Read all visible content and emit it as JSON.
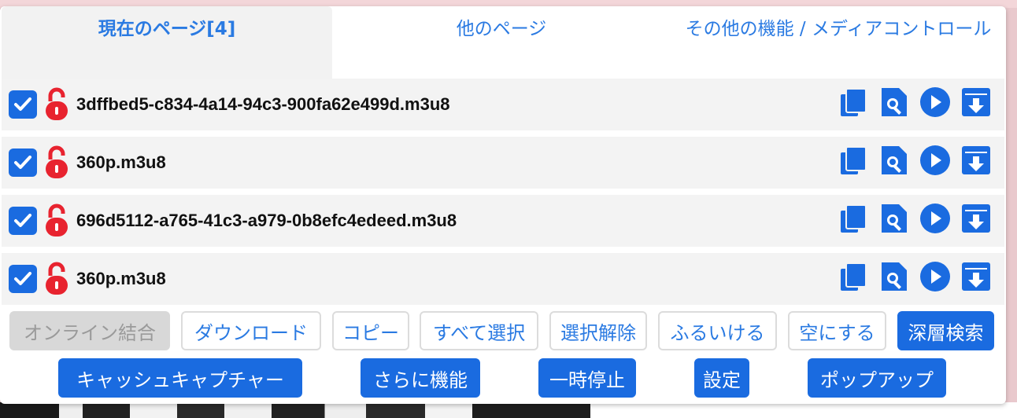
{
  "tabs": [
    {
      "label": "現在のページ[4]"
    },
    {
      "label": "他のページ"
    },
    {
      "label": "その他の機能 / メディアコントロール"
    }
  ],
  "files": [
    {
      "name": "3dffbed5-c834-4a14-94c3-900fa62e499d.m3u8",
      "checked": true
    },
    {
      "name": "360p.m3u8",
      "checked": true
    },
    {
      "name": "696d5112-a765-41c3-a979-0b8efc4edeed.m3u8",
      "checked": true
    },
    {
      "name": "360p.m3u8",
      "checked": true
    }
  ],
  "row_actions": [
    "copy-icon",
    "search-file-icon",
    "play-icon",
    "download-icon"
  ],
  "buttons_row1": [
    {
      "label": "オンライン結合",
      "state": "disabled"
    },
    {
      "label": "ダウンロード",
      "state": "normal"
    },
    {
      "label": "コピー",
      "state": "normal"
    },
    {
      "label": "すべて選択",
      "state": "normal"
    },
    {
      "label": "選択解除",
      "state": "normal"
    },
    {
      "label": "ふるいける",
      "state": "normal"
    },
    {
      "label": "空にする",
      "state": "normal"
    },
    {
      "label": "深層検索",
      "state": "primary"
    }
  ],
  "buttons_row2": [
    {
      "label": "キャッシュキャプチャー"
    },
    {
      "label": "さらに機能"
    },
    {
      "label": "一時停止"
    },
    {
      "label": "設定"
    },
    {
      "label": "ポップアップ"
    }
  ],
  "colors": {
    "accent": "#2a7ae2",
    "primary": "#1a6be0",
    "lock": "#e8232f"
  }
}
